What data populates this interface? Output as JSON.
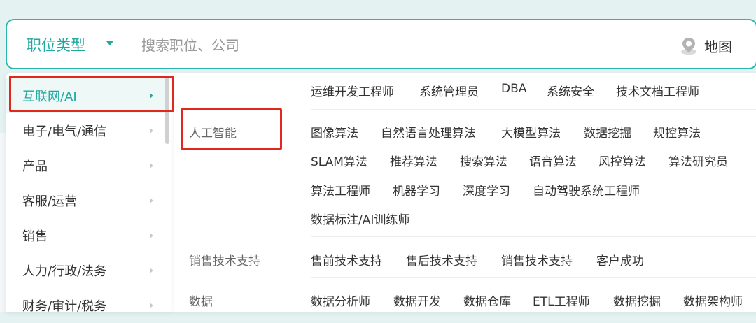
{
  "search": {
    "job_type_label": "职位类型",
    "placeholder": "搜索职位、公司",
    "map_label": "地图"
  },
  "categories": [
    {
      "label": "互联网/AI",
      "active": true
    },
    {
      "label": "电子/电气/通信"
    },
    {
      "label": "产品"
    },
    {
      "label": "客服/运营"
    },
    {
      "label": "销售"
    },
    {
      "label": "人力/行政/法务"
    },
    {
      "label": "财务/审计/税务"
    }
  ],
  "sections": [
    {
      "label": "",
      "rows": [
        [
          "运维开发工程师",
          "系统管理员",
          "DBA",
          "系统安全",
          "技术文档工程师"
        ]
      ]
    },
    {
      "label": "人工智能",
      "rows": [
        [
          "图像算法",
          "自然语言处理算法",
          "大模型算法",
          "数据挖掘",
          "规控算法"
        ],
        [
          "SLAM算法",
          "推荐算法",
          "搜索算法",
          "语音算法",
          "风控算法",
          "算法研究员"
        ],
        [
          "算法工程师",
          "机器学习",
          "深度学习",
          "自动驾驶系统工程师"
        ],
        [
          "数据标注/AI训练师"
        ]
      ]
    },
    {
      "label": "销售技术支持",
      "rows": [
        [
          "售前技术支持",
          "售后技术支持",
          "销售技术支持",
          "客户成功"
        ]
      ]
    },
    {
      "label": "数据",
      "rows": [
        [
          "数据分析师",
          "数据开发",
          "数据仓库",
          "ETL工程师",
          "数据挖掘",
          "数据架构师"
        ]
      ]
    }
  ],
  "colors": {
    "accent": "#1fa9a1",
    "highlight_box": "#e0281d"
  },
  "icons": {
    "map": "map-pin-icon",
    "dropdown": "caret-down-icon",
    "category_arrow": "chevron-right-icon"
  }
}
